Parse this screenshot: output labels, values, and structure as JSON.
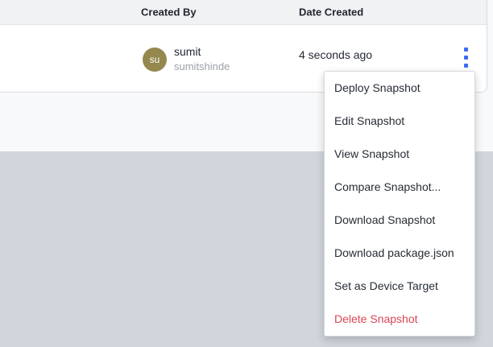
{
  "table": {
    "header": {
      "created_by": "Created By",
      "date_created": "Date Created"
    },
    "row": {
      "avatar_initials": "su",
      "name": "sumit",
      "username": "sumitshinde",
      "date_created": "4 seconds ago"
    }
  },
  "menu": {
    "items": [
      {
        "label": "Deploy Snapshot"
      },
      {
        "label": "Edit Snapshot"
      },
      {
        "label": "View Snapshot"
      },
      {
        "label": "Compare Snapshot..."
      },
      {
        "label": "Download Snapshot"
      },
      {
        "label": "Download package.json"
      },
      {
        "label": "Set as Device Target"
      },
      {
        "label": "Delete Snapshot"
      }
    ]
  },
  "icons": {
    "more_options": "more-vert-icon"
  },
  "colors": {
    "accent_blue": "#3d6bf3",
    "danger_red": "#db4655",
    "avatar_olive": "#95884e",
    "header_bg": "#f1f2f4",
    "page_bg": "#f8f9fa",
    "backdrop_gray": "#d2d5db"
  }
}
